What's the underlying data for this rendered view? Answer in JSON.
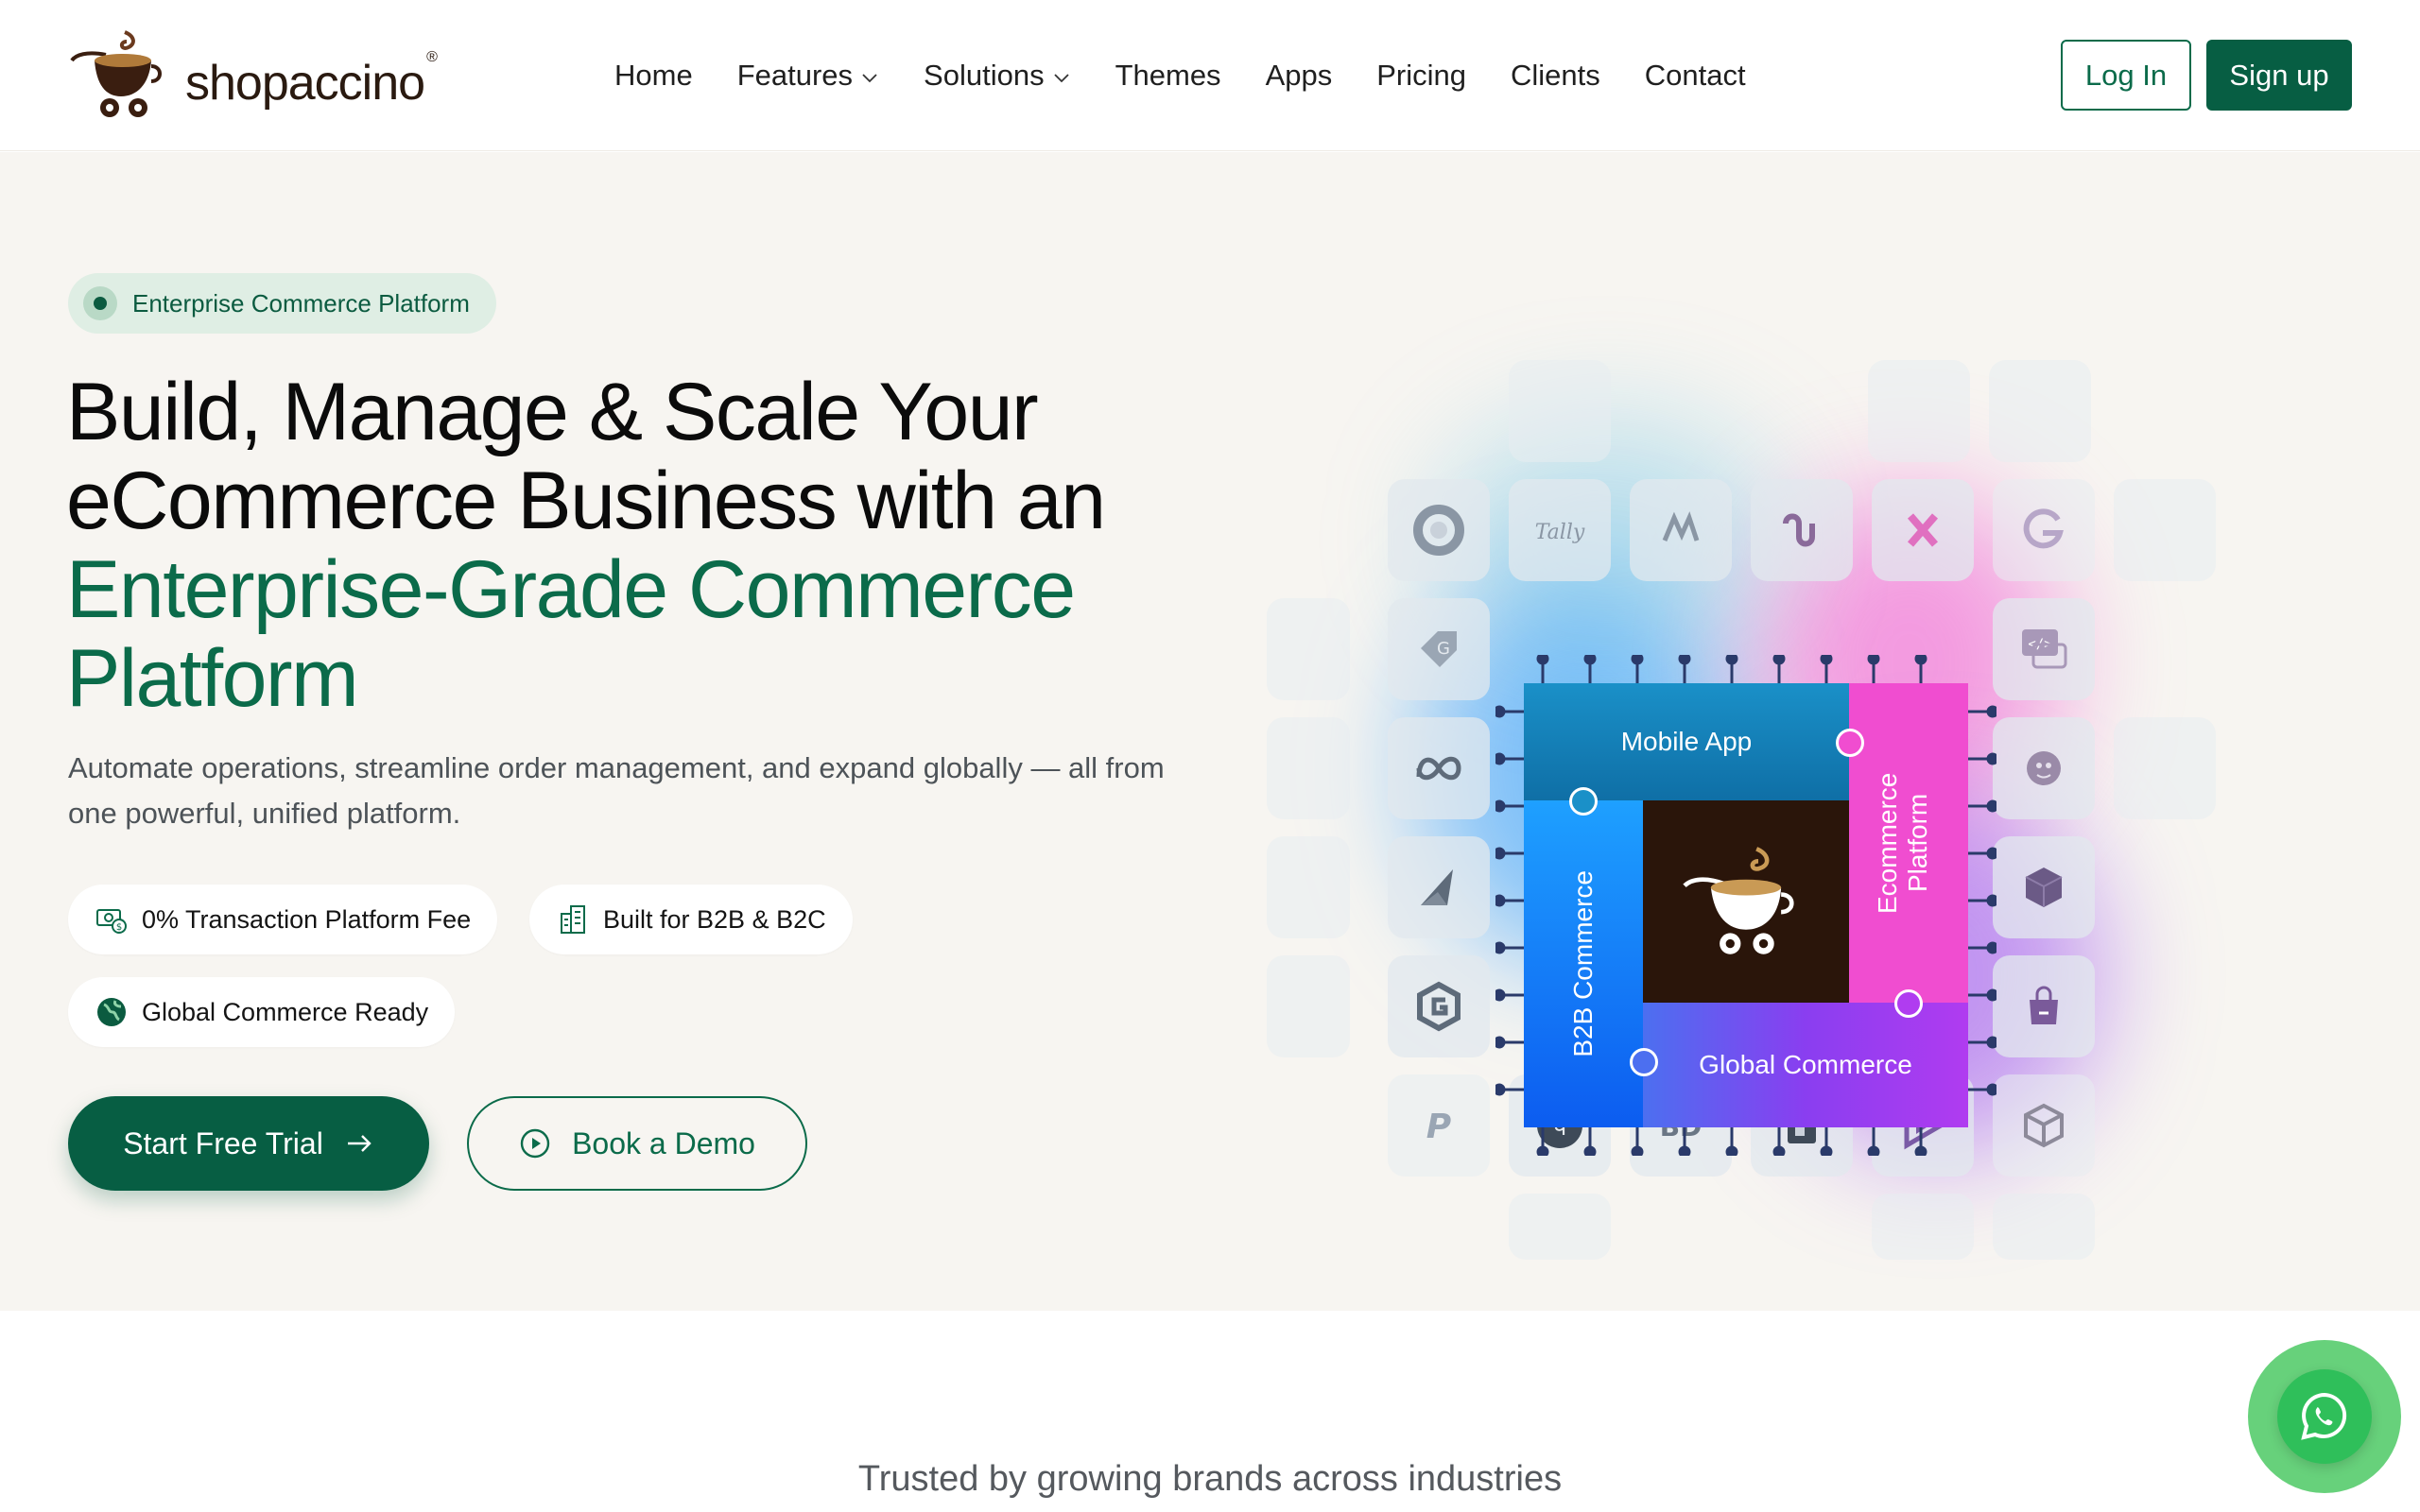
{
  "header": {
    "logo_text": "shopaccino",
    "logo_mark": "®",
    "nav": [
      {
        "label": "Home"
      },
      {
        "label": "Features"
      },
      {
        "label": "Solutions"
      },
      {
        "label": "Themes"
      },
      {
        "label": "Apps"
      },
      {
        "label": "Pricing"
      },
      {
        "label": "Clients"
      },
      {
        "label": "Contact"
      }
    ],
    "login_label": "Log In",
    "signup_label": "Sign up"
  },
  "hero": {
    "badge": "Enterprise Commerce Platform",
    "headline_line1": "Build, Manage & Scale Your",
    "headline_line2": "eCommerce Business with an",
    "headline_green": "Enterprise-Grade Commerce Platform",
    "subtext": "Automate operations, streamline order management, and expand globally — all from one powerful, unified platform.",
    "chips": [
      {
        "label": "0% Transaction Platform Fee",
        "icon": "money-icon"
      },
      {
        "label": "Built for B2B & B2C",
        "icon": "building-icon"
      },
      {
        "label": "Global Commerce Ready",
        "icon": "globe-icon"
      }
    ],
    "cta_primary": "Start Free Trial",
    "cta_secondary": "Book a Demo"
  },
  "illustration": {
    "pieces": {
      "mobile": "Mobile App",
      "ecommerce": "Ecommerce Platform",
      "b2b": "B2B Commerce",
      "global": "Global Commerce"
    }
  },
  "trusted": {
    "text": "Trusted by growing brands across industries"
  },
  "colors": {
    "brand_green": "#075e43",
    "hero_bg": "#f7f5f1",
    "badge_bg": "#dfeee4"
  }
}
